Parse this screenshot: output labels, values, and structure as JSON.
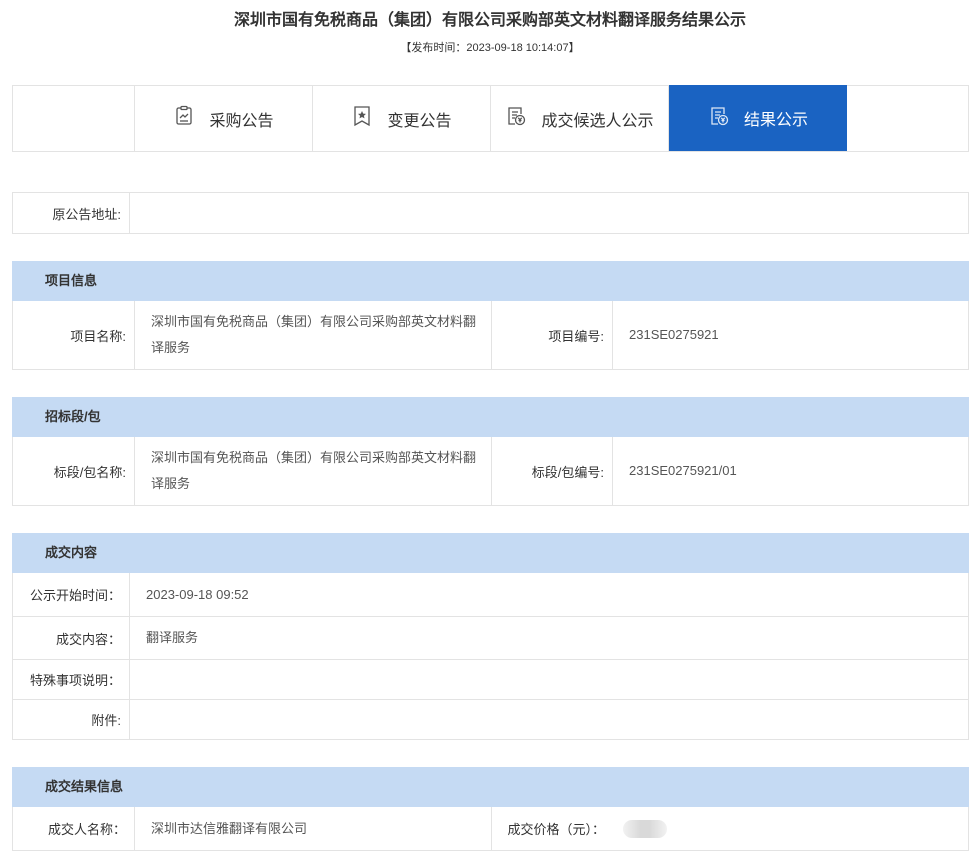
{
  "page": {
    "title": "深圳市国有免税商品（集团）有限公司采购部英文材料翻译服务结果公示",
    "publish_time": "【发布时间：2023-09-18 10:14:07】"
  },
  "tabs": [
    {
      "label": "采购公告",
      "icon": "document-edit-icon"
    },
    {
      "label": "变更公告",
      "icon": "bookmark-star-icon"
    },
    {
      "label": "成交候选人公示",
      "icon": "document-yen-icon"
    },
    {
      "label": "结果公示",
      "icon": "document-yen-icon",
      "active": true
    }
  ],
  "original": {
    "label": "原公告地址:",
    "value": ""
  },
  "project": {
    "header": "项目信息",
    "name_label": "项目名称:",
    "name_value_line1": "深圳市国有免税商品（集团）有限公司采购部英文材料翻",
    "name_value_line2": "译服务",
    "code_label": "项目编号:",
    "code_value": "231SE0275921"
  },
  "package": {
    "header": "招标段/包",
    "name_label": "标段/包名称:",
    "name_value_line1": "深圳市国有免税商品（集团）有限公司采购部英文材料翻",
    "name_value_line2": "译服务",
    "code_label": "标段/包编号:",
    "code_value": "231SE0275921/01"
  },
  "deal": {
    "header": "成交内容",
    "start_label": "公示开始时间：",
    "start_value": "2023-09-18 09:52",
    "content_label": "成交内容：",
    "content_value": "翻译服务",
    "note_label": "特殊事项说明：",
    "note_value": "",
    "attach_label": "附件:",
    "attach_value": ""
  },
  "result": {
    "header": "成交结果信息",
    "winner_label": "成交人名称：",
    "winner_value": "深圳市达信雅翻译有限公司",
    "price_label": "成交价格（元）："
  },
  "colors": {
    "accent": "#1a63c2",
    "section_bg": "#c5daf3",
    "border": "#e3e3e3"
  }
}
